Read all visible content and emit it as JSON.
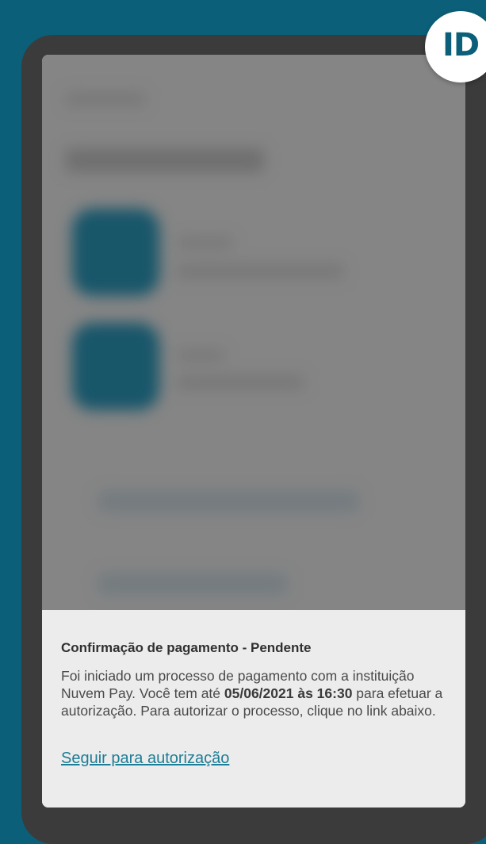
{
  "badge": {
    "text": "ID"
  },
  "notification": {
    "title": "Confirmação de pagamento - Pendente",
    "body_part1": "Foi iniciado um processo de pagamento com a instituição Nuvem Pay. Você tem até ",
    "body_deadline": "05/06/2021 às 16:30",
    "body_part2": " para efetuar a autorização. Para autorizar o processo, clique no link abaixo.",
    "link_label": "Seguir para autorização"
  },
  "colors": {
    "background": "#0b5f78",
    "phone_frame": "#3b3b3b",
    "sheet": "#ececec",
    "link": "#1d7d96"
  }
}
